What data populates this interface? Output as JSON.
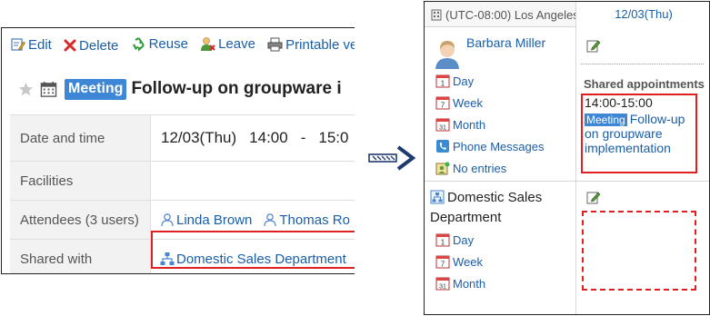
{
  "left": {
    "toolbar": {
      "edit": "Edit",
      "delete": "Delete",
      "reuse": "Reuse",
      "leave": "Leave",
      "printable": "Printable ve"
    },
    "title_badge": "Meeting",
    "title": "Follow-up on groupware i",
    "details": {
      "date_label": "Date and time",
      "date": "12/03(Thu)",
      "start": "14:00",
      "dash": "-",
      "end": "15:0",
      "facilities_label": "Facilities",
      "attendees_label": "Attendees (3 users)",
      "attendees": [
        "Linda Brown",
        "Thomas Ro"
      ],
      "shared_label": "Shared with",
      "shared_value": "Domestic Sales Department"
    }
  },
  "right": {
    "timezone": "(UTC-08:00) Los Angeles",
    "date": "12/03(Thu)",
    "user": {
      "name": "Barbara Miller",
      "menu": [
        "Day",
        "Week",
        "Month",
        "Phone Messages",
        "No entries"
      ]
    },
    "shared_title": "Shared appointments",
    "appointment": {
      "time": "14:00-15:00",
      "badge": "Meeting",
      "title": "Follow-up on groupware implementation"
    },
    "group": {
      "name": "Domestic Sales Department",
      "menu": [
        "Day",
        "Week",
        "Month"
      ]
    }
  },
  "colors": {
    "link": "#1a5ea8",
    "badge": "#3e86d6",
    "highlight": "#e02020",
    "arrow": "#1f3a6e"
  }
}
